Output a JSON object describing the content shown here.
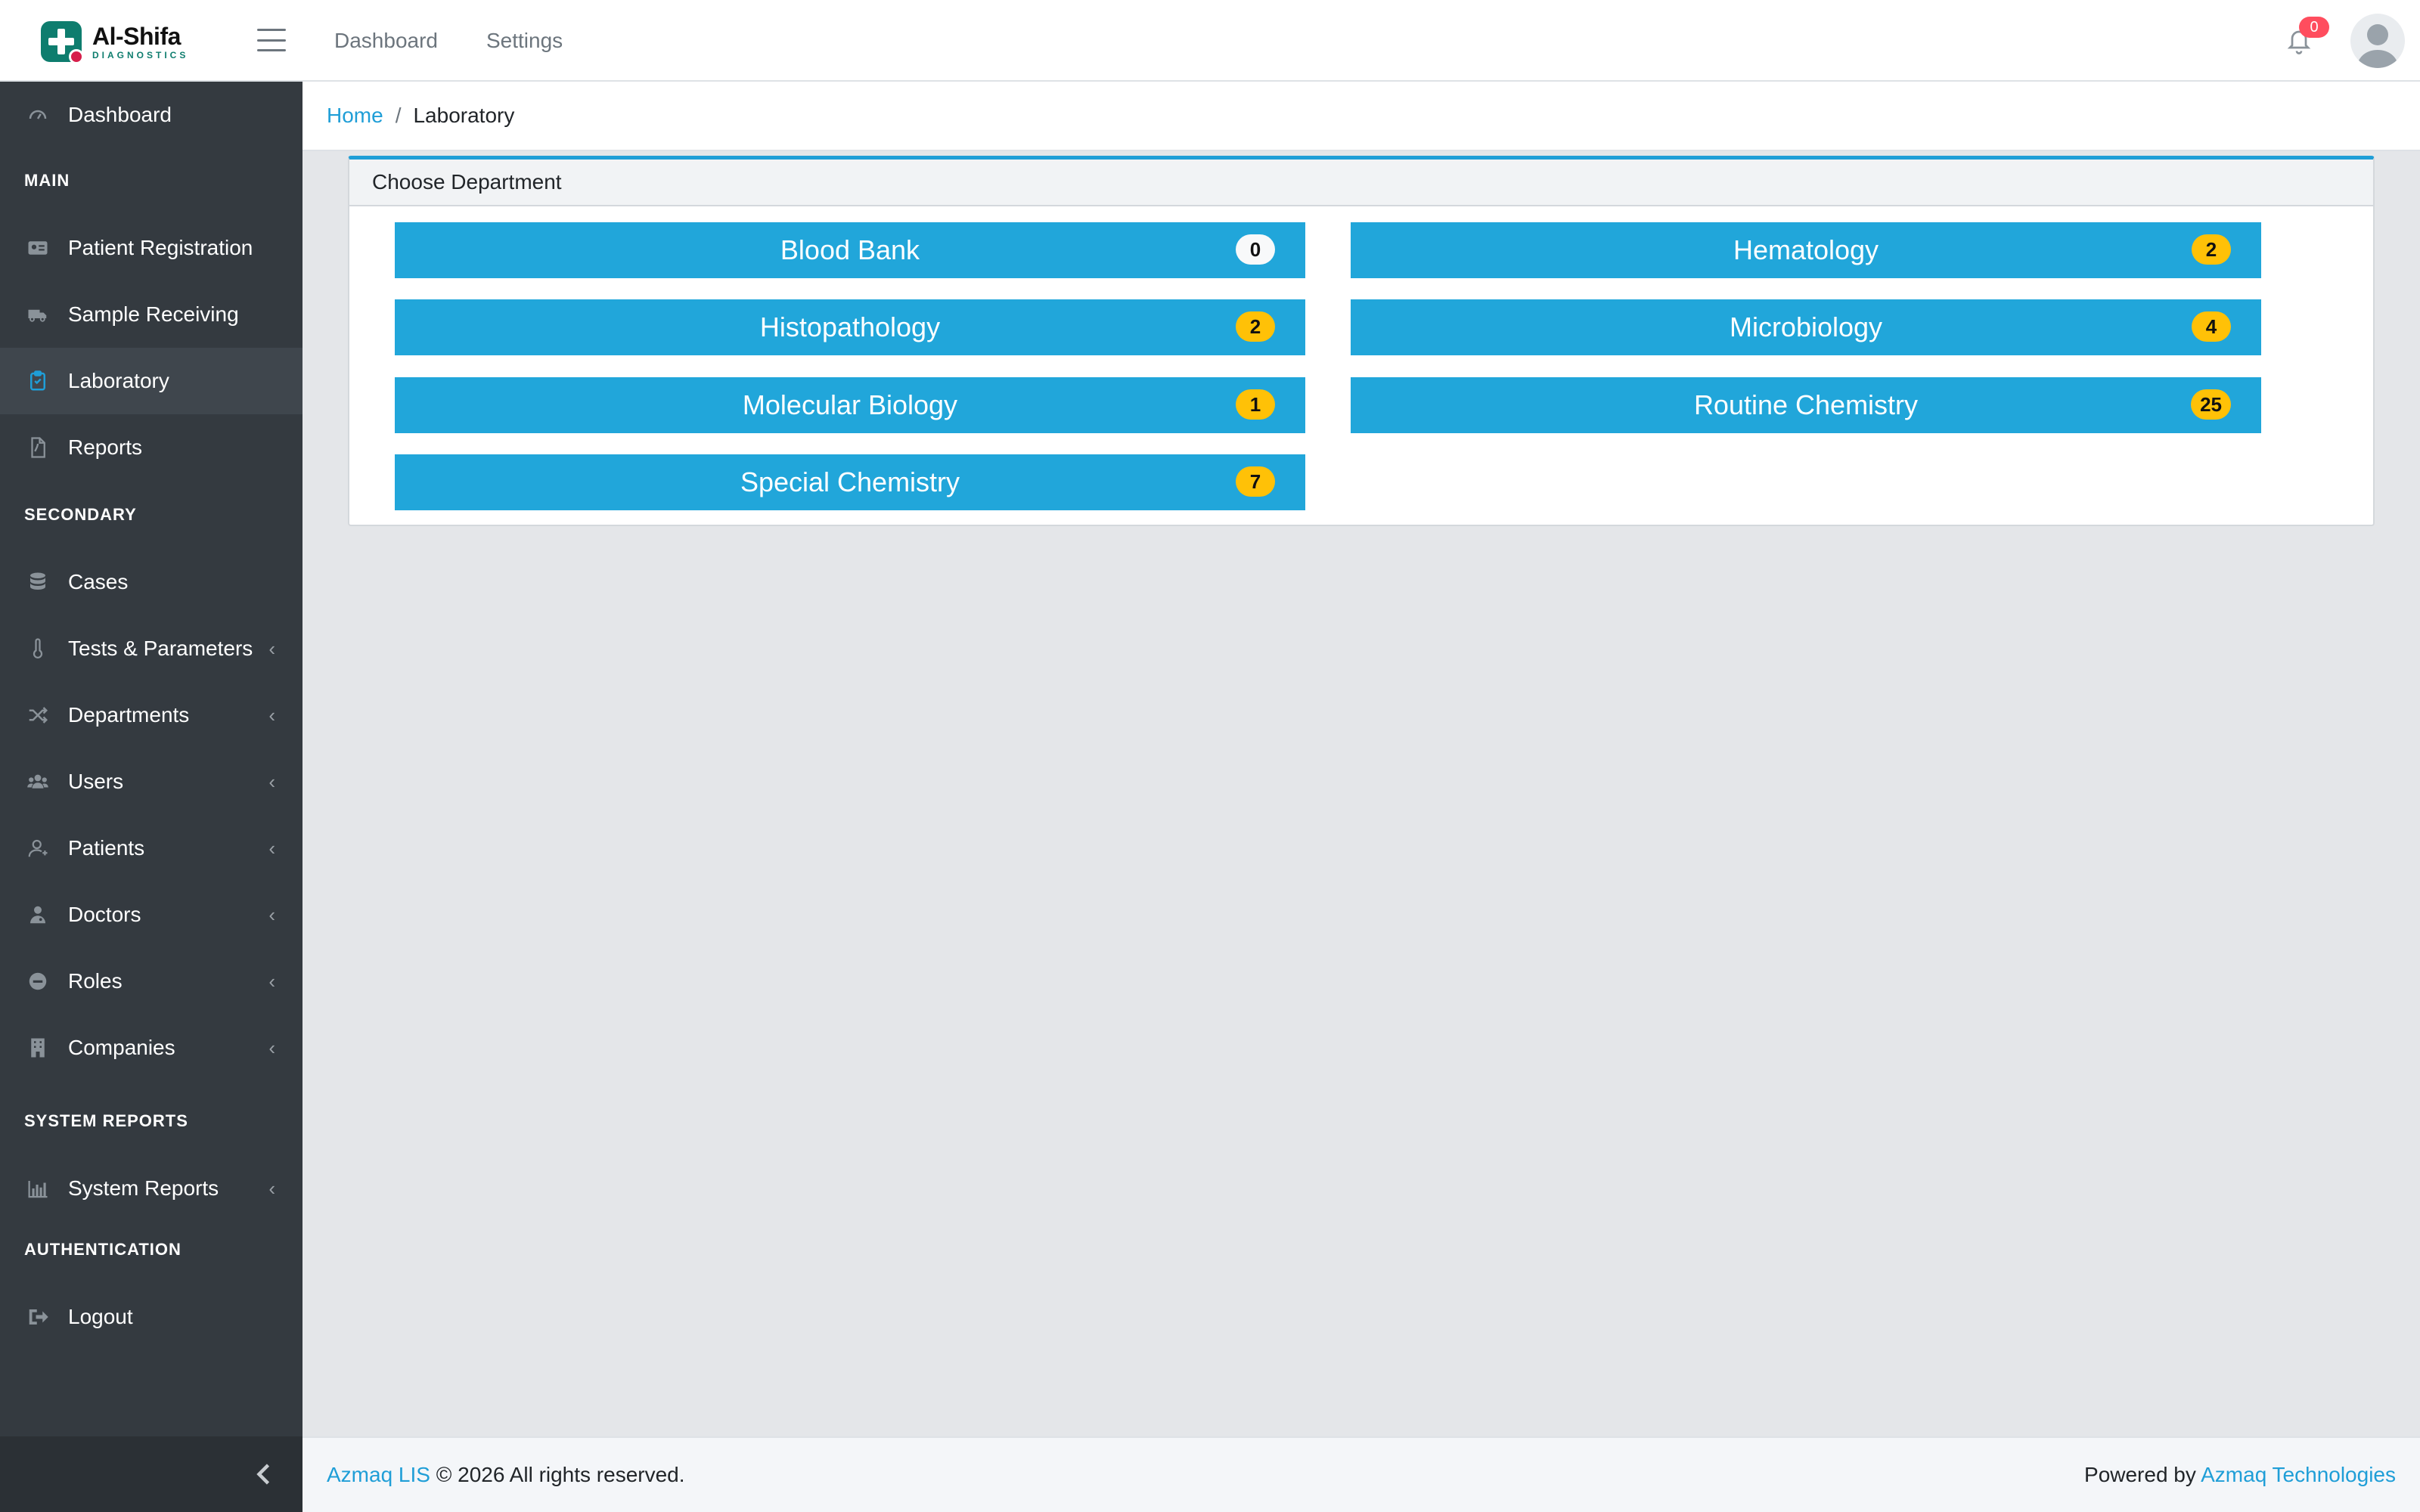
{
  "brand": {
    "name": "Al-Shifa",
    "subtitle": "DIAGNOSTICS",
    "primary_color": "#0e7d6e",
    "accent_color": "#d61f4b"
  },
  "topnav": {
    "links": [
      "Dashboard",
      "Settings"
    ],
    "notification_count": "0"
  },
  "sidebar": {
    "dashboard": "Dashboard",
    "main_header": "MAIN",
    "main_items": [
      "Patient Registration",
      "Sample Receiving",
      "Laboratory",
      "Reports"
    ],
    "active_item": "Laboratory",
    "secondary_header": "SECONDARY",
    "secondary_items": [
      "Cases",
      "Tests & Parameters",
      "Departments",
      "Users",
      "Patients",
      "Doctors",
      "Roles",
      "Companies"
    ],
    "system_header": "SYSTEM REPORTS",
    "system_items": [
      "System Reports"
    ],
    "auth_header": "AUTHENTICATION",
    "auth_items": [
      "Logout"
    ],
    "icons": {
      "dashboard": "gauge-icon",
      "patient_registration": "id-card-icon",
      "sample_receiving": "ambulance-icon",
      "laboratory": "clipboard-icon",
      "reports": "pdf-file-icon",
      "cases": "database-icon",
      "tests": "thermometer-icon",
      "departments": "shuffle-icon",
      "users": "users-icon",
      "patients": "user-outline-icon",
      "doctors": "doctor-icon",
      "roles": "minus-circle-icon",
      "companies": "building-icon",
      "system_reports": "bar-chart-icon",
      "logout": "sign-out-icon"
    }
  },
  "breadcrumb": {
    "home": "Home",
    "separator": "/",
    "current": "Laboratory"
  },
  "card": {
    "title": "Choose Department",
    "accent_color": "#21a6da",
    "departments": [
      {
        "name": "Blood Bank",
        "count": "0"
      },
      {
        "name": "Hematology",
        "count": "2"
      },
      {
        "name": "Histopathology",
        "count": "2"
      },
      {
        "name": "Microbiology",
        "count": "4"
      },
      {
        "name": "Molecular Biology",
        "count": "1"
      },
      {
        "name": "Routine Chemistry",
        "count": "25"
      },
      {
        "name": "Special Chemistry",
        "count": "7"
      }
    ]
  },
  "footer": {
    "product": "Azmaq LIS",
    "copyright": " © 2026 All rights reserved.",
    "powered_prefix": "Powered by ",
    "company": "Azmaq Technologies"
  }
}
